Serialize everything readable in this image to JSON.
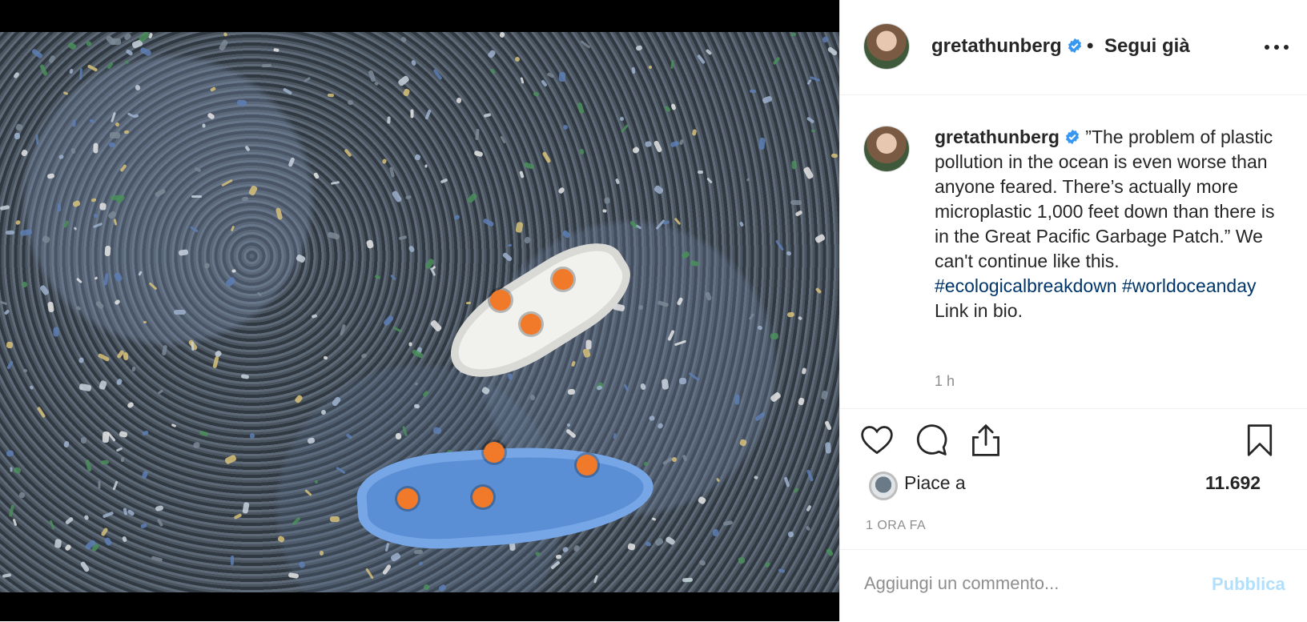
{
  "header": {
    "username": "gretathunberg",
    "separator": "•",
    "follow_status": "Segui già"
  },
  "caption": {
    "username": "gretathunberg",
    "text": "”The problem of plastic pollution in the ocean is even worse than anyone feared. There’s actually more microplastic 1,000 feet down than there is in the Great Pacific Garbage Patch.” We can't continue like this.",
    "hashtags": [
      "#ecologicalbreakdown",
      "#worldoceanday"
    ],
    "footer": "Link in bio.",
    "timestamp": "1 h"
  },
  "actions": {
    "icons": [
      "heart-icon",
      "comment-icon",
      "share-icon",
      "bookmark-icon"
    ]
  },
  "likes": {
    "label": "Piace a",
    "count": "11.692"
  },
  "post_age": "1 ORA FA",
  "comment_box": {
    "placeholder": "Aggiungi un commento...",
    "publish_label": "Pubblica"
  },
  "colors": {
    "verified": "#3897f0",
    "hashtag": "#003569",
    "publish_disabled": "#b2dffc",
    "muted": "#8e8e8e"
  }
}
